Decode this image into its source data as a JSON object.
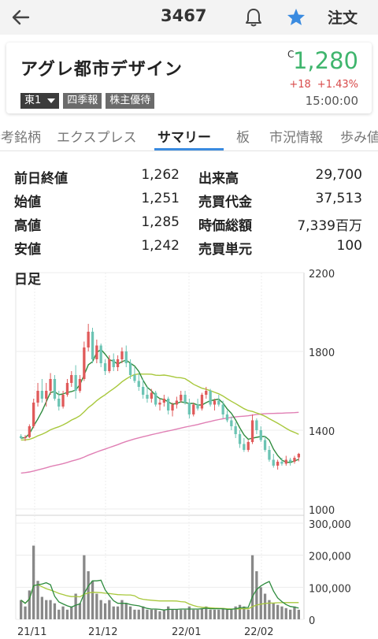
{
  "header": {
    "code": "3467",
    "order_label": "注文"
  },
  "stock": {
    "name": "アグレ都市デザイン",
    "market": "東1",
    "badges": [
      "四季報",
      "株主優待"
    ],
    "close_mark": "C",
    "price": "1,280",
    "change": "+18",
    "change_pct": "+1.43%",
    "time": "15:00:00",
    "colors": {
      "up": "#d84a4a",
      "price": "#3fb56d",
      "accent": "#3a8be0"
    }
  },
  "tabs": [
    {
      "label": "参考銘柄",
      "active": false
    },
    {
      "label": "エクスプレス",
      "active": false
    },
    {
      "label": "サマリー",
      "active": true
    },
    {
      "label": "板",
      "active": false
    },
    {
      "label": "市況情報",
      "active": false
    },
    {
      "label": "歩み値",
      "active": false
    }
  ],
  "stats": {
    "prev_close_label": "前日終値",
    "prev_close": "1,262",
    "volume_label": "出来高",
    "volume": "29,700",
    "open_label": "始値",
    "open": "1,251",
    "turnover_label": "売買代金",
    "turnover": "37,513",
    "high_label": "高値",
    "high": "1,285",
    "market_cap_label": "時価総額",
    "market_cap": "7,339百万",
    "low_label": "安値",
    "low": "1,242",
    "unit_label": "売買単元",
    "unit": "100"
  },
  "chart_label": "日足",
  "chart_data": {
    "type": "candlestick",
    "price_ticks": [
      "2200",
      "1800",
      "1400",
      "1000"
    ],
    "price_tick_values": [
      2200,
      1800,
      1400,
      1000
    ],
    "volume_ticks": [
      "300,000",
      "200,000",
      "100,000",
      "0"
    ],
    "volume_tick_values": [
      300000,
      200000,
      100000,
      0
    ],
    "x_ticks": [
      "21/11",
      "21/12",
      "22/01",
      "22/02"
    ],
    "colors": {
      "up": "#e05a5a",
      "down": "#6cc4b4",
      "ma_short": "#2e8b3e",
      "ma_mid": "#a8c83c",
      "ma_long": "#e07fb4",
      "volume": "#888888"
    },
    "ohlc": [
      [
        1370,
        1380,
        1355,
        1360
      ],
      [
        1360,
        1375,
        1345,
        1365
      ],
      [
        1365,
        1430,
        1360,
        1420
      ],
      [
        1420,
        1560,
        1410,
        1540
      ],
      [
        1540,
        1640,
        1520,
        1600
      ],
      [
        1600,
        1660,
        1540,
        1560
      ],
      [
        1560,
        1640,
        1520,
        1600
      ],
      [
        1600,
        1690,
        1580,
        1660
      ],
      [
        1660,
        1680,
        1550,
        1560
      ],
      [
        1560,
        1600,
        1500,
        1520
      ],
      [
        1520,
        1600,
        1510,
        1580
      ],
      [
        1580,
        1660,
        1570,
        1640
      ],
      [
        1640,
        1700,
        1620,
        1680
      ],
      [
        1680,
        1730,
        1560,
        1600
      ],
      [
        1600,
        1680,
        1590,
        1660
      ],
      [
        1660,
        1850,
        1650,
        1820
      ],
      [
        1820,
        1940,
        1800,
        1900
      ],
      [
        1900,
        1920,
        1740,
        1760
      ],
      [
        1760,
        1860,
        1740,
        1830
      ],
      [
        1830,
        1840,
        1720,
        1740
      ],
      [
        1740,
        1760,
        1680,
        1700
      ],
      [
        1700,
        1780,
        1690,
        1760
      ],
      [
        1760,
        1790,
        1700,
        1720
      ],
      [
        1720,
        1780,
        1700,
        1760
      ],
      [
        1760,
        1820,
        1740,
        1800
      ],
      [
        1800,
        1830,
        1720,
        1740
      ],
      [
        1740,
        1760,
        1660,
        1680
      ],
      [
        1680,
        1720,
        1640,
        1650
      ],
      [
        1650,
        1690,
        1600,
        1620
      ],
      [
        1620,
        1660,
        1560,
        1580
      ],
      [
        1580,
        1620,
        1540,
        1560
      ],
      [
        1560,
        1610,
        1540,
        1590
      ],
      [
        1590,
        1600,
        1520,
        1530
      ],
      [
        1530,
        1560,
        1500,
        1540
      ],
      [
        1540,
        1580,
        1520,
        1560
      ],
      [
        1560,
        1570,
        1480,
        1500
      ],
      [
        1500,
        1540,
        1470,
        1530
      ],
      [
        1530,
        1570,
        1510,
        1550
      ],
      [
        1550,
        1600,
        1540,
        1580
      ],
      [
        1580,
        1600,
        1530,
        1540
      ],
      [
        1540,
        1560,
        1460,
        1480
      ],
      [
        1480,
        1540,
        1470,
        1530
      ],
      [
        1530,
        1560,
        1500,
        1510
      ],
      [
        1510,
        1590,
        1500,
        1580
      ],
      [
        1580,
        1620,
        1560,
        1600
      ],
      [
        1600,
        1610,
        1520,
        1530
      ],
      [
        1530,
        1560,
        1500,
        1550
      ],
      [
        1550,
        1580,
        1520,
        1530
      ],
      [
        1530,
        1550,
        1460,
        1480
      ],
      [
        1480,
        1500,
        1440,
        1450
      ],
      [
        1450,
        1470,
        1400,
        1420
      ],
      [
        1420,
        1440,
        1360,
        1380
      ],
      [
        1380,
        1400,
        1310,
        1330
      ],
      [
        1330,
        1360,
        1290,
        1300
      ],
      [
        1300,
        1350,
        1290,
        1340
      ],
      [
        1340,
        1480,
        1330,
        1450
      ],
      [
        1450,
        1460,
        1380,
        1400
      ],
      [
        1400,
        1420,
        1340,
        1350
      ],
      [
        1350,
        1370,
        1290,
        1300
      ],
      [
        1300,
        1320,
        1240,
        1250
      ],
      [
        1250,
        1280,
        1210,
        1220
      ],
      [
        1220,
        1250,
        1200,
        1240
      ],
      [
        1240,
        1260,
        1220,
        1230
      ],
      [
        1230,
        1270,
        1220,
        1250
      ],
      [
        1250,
        1260,
        1220,
        1240
      ],
      [
        1240,
        1270,
        1230,
        1260
      ],
      [
        1262,
        1285,
        1242,
        1280
      ]
    ],
    "volume": [
      60000,
      40000,
      90000,
      230000,
      120000,
      70000,
      60000,
      60000,
      50000,
      30000,
      40000,
      30000,
      40000,
      80000,
      50000,
      200000,
      150000,
      120000,
      80000,
      60000,
      50000,
      60000,
      40000,
      40000,
      60000,
      50000,
      40000,
      30000,
      30000,
      40000,
      30000,
      30000,
      30000,
      25000,
      30000,
      40000,
      30000,
      30000,
      30000,
      30000,
      40000,
      30000,
      30000,
      35000,
      40000,
      30000,
      30000,
      30000,
      35000,
      30000,
      30000,
      40000,
      45000,
      40000,
      30000,
      200000,
      150000,
      100000,
      80000,
      60000,
      50000,
      45000,
      40000,
      35000,
      30000,
      40000,
      29700
    ]
  }
}
